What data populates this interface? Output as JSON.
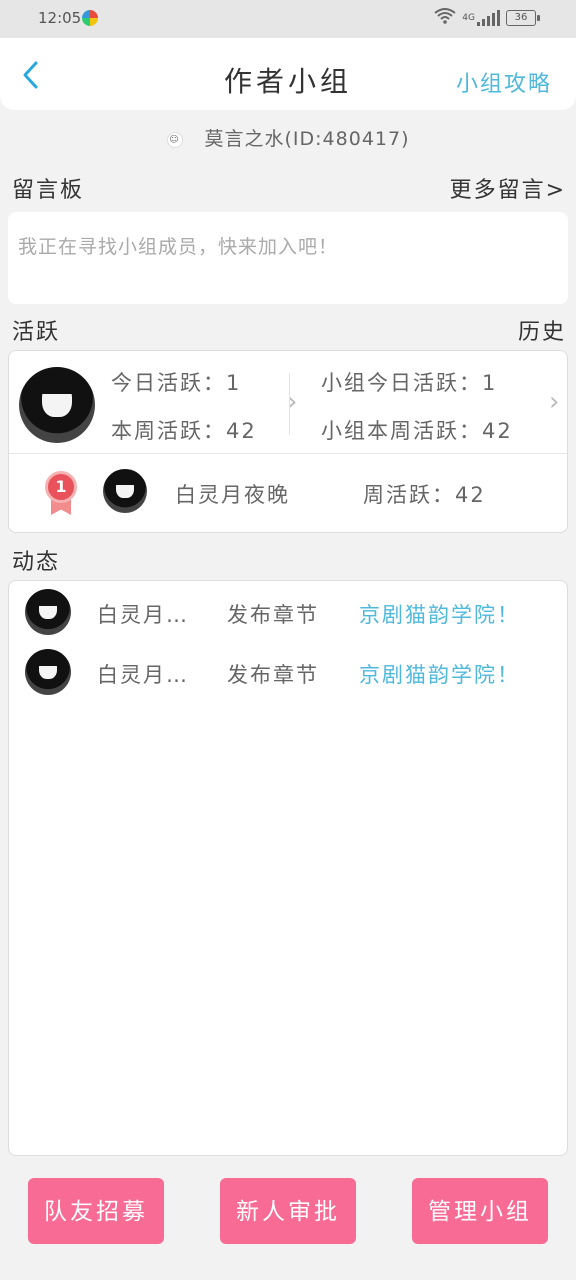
{
  "status_bar": {
    "time": "12:05",
    "network": "4G",
    "battery": "36"
  },
  "header": {
    "back_icon": "chevron-left-icon",
    "title": "作者小组",
    "guide_link": "小组攻略"
  },
  "owner": {
    "name": "莫言之水(ID:480417)"
  },
  "message_board": {
    "title": "留言板",
    "more_link": "更多留言>",
    "placeholder": "我正在寻找小组成员，快来加入吧！"
  },
  "activity": {
    "title": "活跃",
    "history_link": "历史",
    "my_today": "今日活跃：1",
    "my_week": "本周活跃：42",
    "group_today": "小组今日活跃：1",
    "group_week": "小组本周活跃：42",
    "ranking": [
      {
        "rank": "1",
        "name": "白灵月夜晚",
        "weekly": "周活跃：42"
      }
    ]
  },
  "feed": {
    "title": "动态",
    "items": [
      {
        "name": "白灵月…",
        "action": "发布章节",
        "book": "京剧猫韵学院！"
      },
      {
        "name": "白灵月…",
        "action": "发布章节",
        "book": "京剧猫韵学院！"
      }
    ]
  },
  "buttons": {
    "recruit": "队友招募",
    "approve": "新人审批",
    "manage": "管理小组"
  },
  "colors": {
    "accent_blue": "#4fb8dd",
    "button_pink": "#f86b95",
    "medal_red": "#e9525a"
  }
}
